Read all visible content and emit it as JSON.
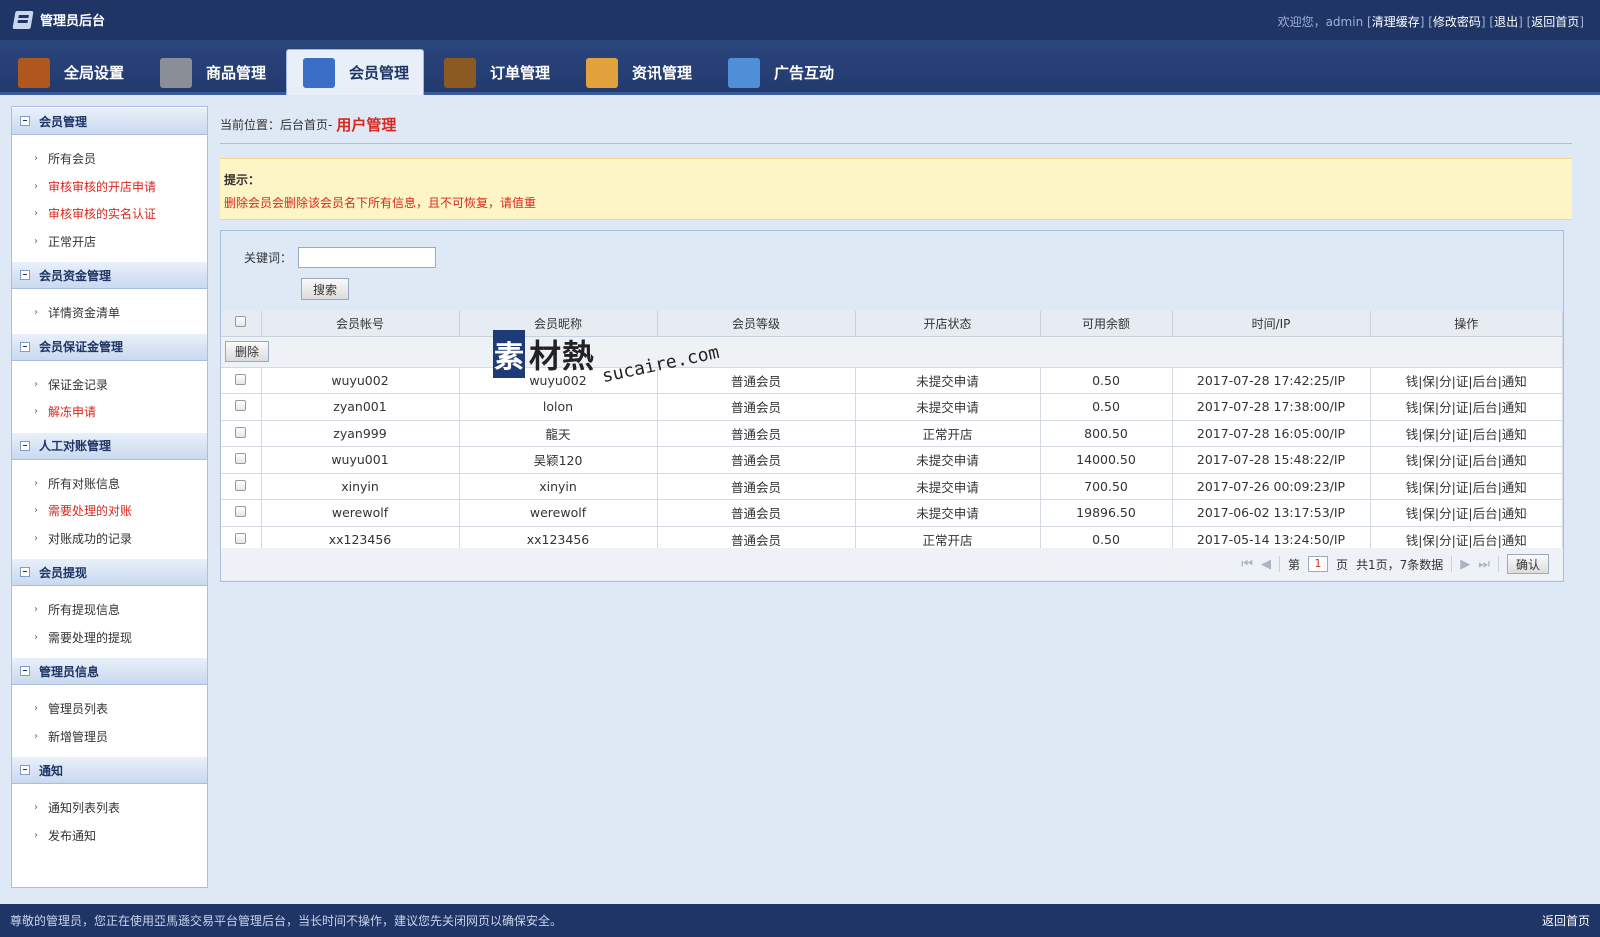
{
  "topbar": {
    "title": "管理员后台",
    "welcome": "欢迎您，admin",
    "links": [
      "清理缓存",
      "修改密码",
      "退出",
      "返回首页"
    ]
  },
  "nav": {
    "tabs": [
      {
        "label": "全局设置",
        "icon": "house-icon",
        "color": "#b0571e"
      },
      {
        "label": "商品管理",
        "icon": "grid-icon",
        "color": "#8a8f97"
      },
      {
        "label": "会员管理",
        "icon": "members-icon",
        "color": "#3b6fc6"
      },
      {
        "label": "订单管理",
        "icon": "wallet-icon",
        "color": "#8a5a22"
      },
      {
        "label": "资讯管理",
        "icon": "book-icon",
        "color": "#e2a23b"
      },
      {
        "label": "广告互动",
        "icon": "window-icon",
        "color": "#4f8fd8"
      }
    ],
    "active_index": 2
  },
  "sidebar": {
    "sections": [
      {
        "title": "会员管理",
        "items": [
          {
            "label": "所有会员",
            "red": false
          },
          {
            "label": "审核审核的开店申请",
            "red": true
          },
          {
            "label": "审核审核的实名认证",
            "red": true
          },
          {
            "label": "正常开店",
            "red": false
          }
        ]
      },
      {
        "title": "会员资金管理",
        "items": [
          {
            "label": "详情资金清单",
            "red": false
          }
        ]
      },
      {
        "title": "会员保证金管理",
        "items": [
          {
            "label": "保证金记录",
            "red": false
          },
          {
            "label": "解冻申请",
            "red": true
          }
        ]
      },
      {
        "title": "人工对账管理",
        "items": [
          {
            "label": "所有对账信息",
            "red": false
          },
          {
            "label": "需要处理的对账",
            "red": true
          },
          {
            "label": "对账成功的记录",
            "red": false
          }
        ]
      },
      {
        "title": "会员提现",
        "items": [
          {
            "label": "所有提现信息",
            "red": false
          },
          {
            "label": "需要处理的提现",
            "red": false
          }
        ]
      },
      {
        "title": "管理员信息",
        "items": [
          {
            "label": "管理员列表",
            "red": false
          },
          {
            "label": "新增管理员",
            "red": false
          }
        ]
      },
      {
        "title": "通知",
        "items": [
          {
            "label": "通知列表列表",
            "red": false
          },
          {
            "label": "发布通知",
            "red": false
          }
        ]
      }
    ]
  },
  "breadcrumb": {
    "prefix": "当前位置：",
    "home": "后台首页",
    "sep": " - ",
    "current": "用户管理"
  },
  "notice": {
    "title": "提示：",
    "text": "删除会员会删除该会员名下所有信息，且不可恢复，请值重"
  },
  "search": {
    "label": "关键词：",
    "value": "",
    "button": "搜索"
  },
  "table": {
    "headers": [
      "会员帐号",
      "会员昵称",
      "会员等级",
      "开店状态",
      "可用余额",
      "时间/IP",
      "操作"
    ],
    "delete_button": "删除",
    "ops": "钱|保|分|证|后台|通知",
    "rows": [
      {
        "account": "wuyu002",
        "nickname": "wuyu002",
        "level": "普通会员",
        "status": "未提交申请",
        "status_type": "gray",
        "balance": "0.50",
        "time": "2017-07-28 17:42:25/IP"
      },
      {
        "account": "zyan001",
        "nickname": "lolon",
        "level": "普通会员",
        "status": "未提交申请",
        "status_type": "gray",
        "balance": "0.50",
        "time": "2017-07-28 17:38:00/IP"
      },
      {
        "account": "zyan999",
        "nickname": "龍天",
        "level": "普通会员",
        "status": "正常开店",
        "status_type": "blue",
        "balance": "800.50",
        "time": "2017-07-28 16:05:00/IP"
      },
      {
        "account": "wuyu001",
        "nickname": "吴颖120",
        "level": "普通会员",
        "status": "未提交申请",
        "status_type": "gray",
        "balance": "14000.50",
        "time": "2017-07-28 15:48:22/IP"
      },
      {
        "account": "xinyin",
        "nickname": "xinyin",
        "level": "普通会员",
        "status": "未提交申请",
        "status_type": "gray",
        "balance": "700.50",
        "time": "2017-07-26 00:09:23/IP"
      },
      {
        "account": "werewolf",
        "nickname": "werewolf",
        "level": "普通会员",
        "status": "未提交申请",
        "status_type": "gray",
        "balance": "19896.50",
        "time": "2017-06-02 13:17:53/IP"
      },
      {
        "account": "xx123456",
        "nickname": "xx123456",
        "level": "普通会员",
        "status": "正常开店",
        "status_type": "blue",
        "balance": "0.50",
        "time": "2017-05-14 13:24:50/IP"
      }
    ]
  },
  "pager": {
    "page_prefix": "第",
    "page_value": "1",
    "page_suffix": "页",
    "summary": "共1页，7条数据",
    "confirm": "确认"
  },
  "watermark": {
    "box": "素",
    "cn": "材熱",
    "en": "sucaire.com"
  },
  "footer": {
    "text": "尊敬的管理员，您正在使用亞馬遜交易平台管理后台，当长时间不操作，建议您先关闭网页以确保安全。",
    "back": "返回首页"
  }
}
